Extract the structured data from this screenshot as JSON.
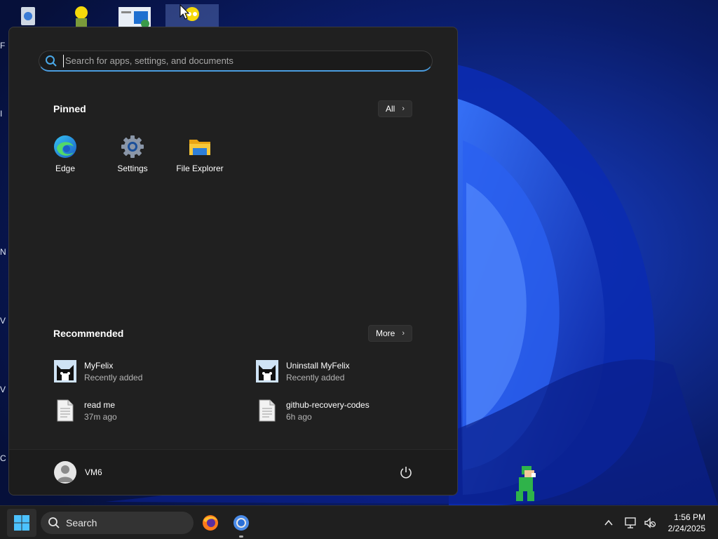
{
  "start_menu": {
    "search": {
      "placeholder": "Search for apps, settings, and documents",
      "value": ""
    },
    "pinned": {
      "title": "Pinned",
      "all_button": "All",
      "apps": [
        {
          "label": "Edge",
          "icon": "edge-icon"
        },
        {
          "label": "Settings",
          "icon": "gear-icon"
        },
        {
          "label": "File Explorer",
          "icon": "folder-icon"
        }
      ]
    },
    "recommended": {
      "title": "Recommended",
      "more_button": "More",
      "items": [
        {
          "name": "MyFelix",
          "sub": "Recently added",
          "icon": "cat-app-icon"
        },
        {
          "name": "Uninstall MyFelix",
          "sub": "Recently added",
          "icon": "cat-app-icon"
        },
        {
          "name": "read me",
          "sub": "37m ago",
          "icon": "document-icon"
        },
        {
          "name": "github-recovery-codes",
          "sub": "6h ago",
          "icon": "document-icon"
        }
      ]
    },
    "user": {
      "name": "VM6"
    }
  },
  "taskbar": {
    "search_label": "Search",
    "time": "1:56 PM",
    "date": "2/24/2025"
  },
  "desktop": {
    "edge_letters": [
      "F",
      "I",
      "N",
      "V",
      "V",
      "C"
    ]
  },
  "colors": {
    "accent": "#4a9de0",
    "menu_bg": "#202020",
    "taskbar_bg": "#1f1f1f"
  }
}
